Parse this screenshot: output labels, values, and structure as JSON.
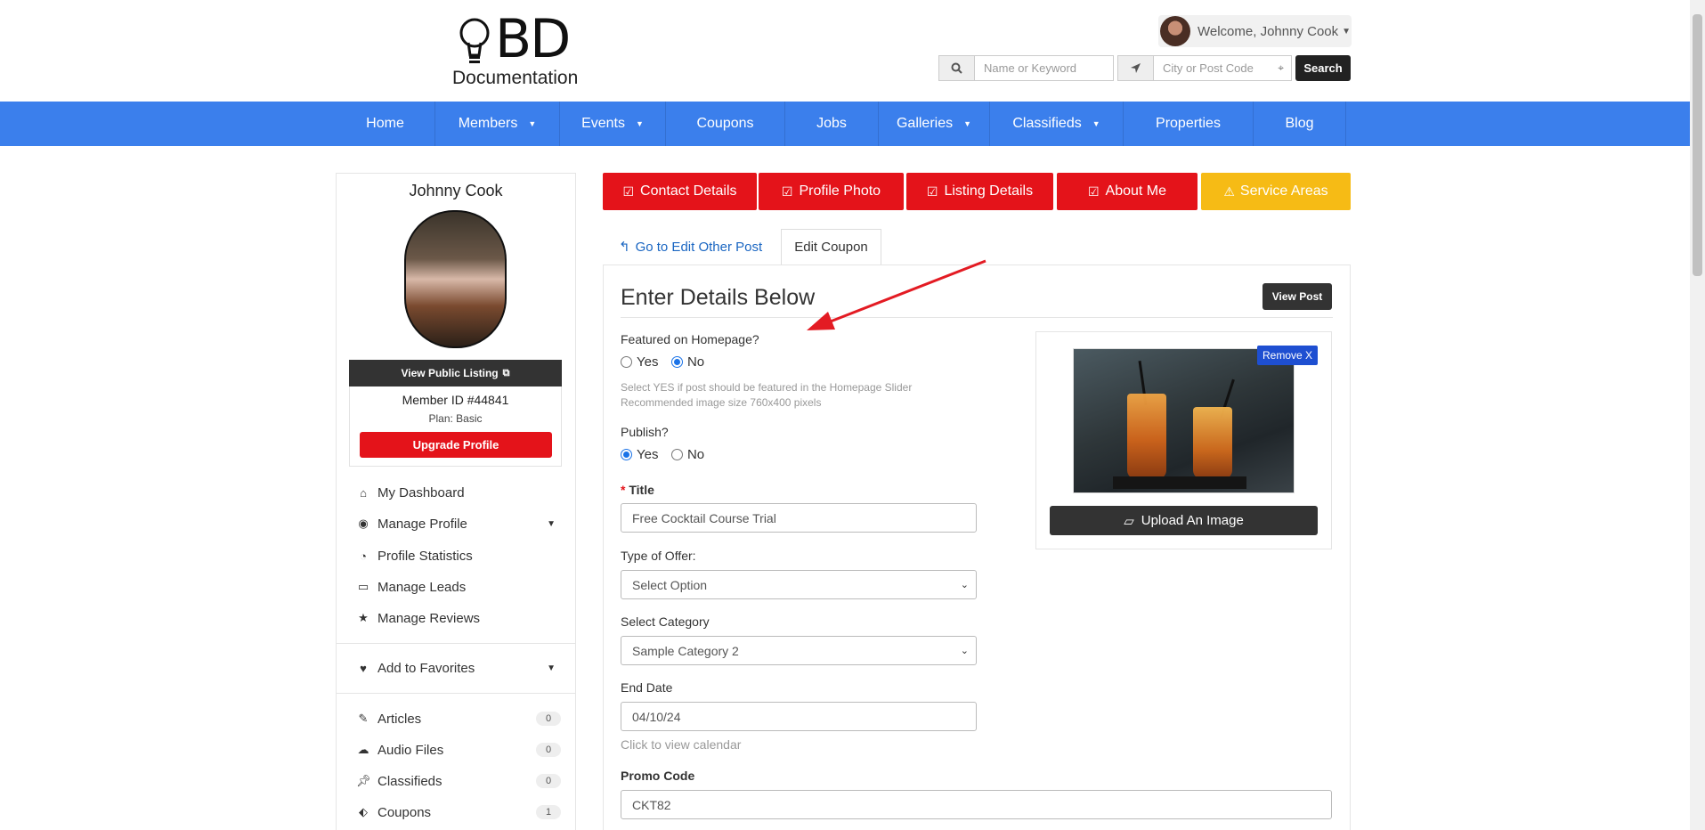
{
  "header": {
    "logo_text": "BD",
    "logo_sub": "Documentation",
    "welcome": "Welcome, Johnny Cook",
    "search_name_placeholder": "Name or Keyword",
    "search_location_placeholder": "City or Post Code",
    "search_button": "Search"
  },
  "nav": {
    "items": [
      {
        "label": "Home"
      },
      {
        "label": "Members",
        "dropdown": "▼"
      },
      {
        "label": "Events",
        "dropdown": "▼"
      },
      {
        "label": "Coupons"
      },
      {
        "label": "Jobs"
      },
      {
        "label": "Galleries",
        "dropdown": "▼"
      },
      {
        "label": "Classifieds",
        "dropdown": "▼"
      },
      {
        "label": "Properties"
      },
      {
        "label": "Blog"
      }
    ]
  },
  "sidebar": {
    "name": "Johnny Cook",
    "view_public_listing": "View Public Listing",
    "member_id": "Member ID #44841",
    "plan": "Plan: Basic",
    "upgrade": "Upgrade Profile",
    "links": [
      {
        "label": "My Dashboard",
        "icon": "home-icon"
      },
      {
        "label": "Manage Profile",
        "icon": "user-circle-icon"
      },
      {
        "label": "Profile Statistics",
        "icon": "pie-chart-icon"
      },
      {
        "label": "Manage Leads",
        "icon": "folder-open-icon"
      },
      {
        "label": "Manage Reviews",
        "icon": "star-icon"
      }
    ],
    "favorites": "Add to Favorites",
    "posts": [
      {
        "label": "Articles",
        "count": "0"
      },
      {
        "label": "Audio Files",
        "count": "0"
      },
      {
        "label": "Classifieds",
        "count": "0"
      },
      {
        "label": "Coupons",
        "count": "1"
      }
    ]
  },
  "top_tabs": {
    "contact": "Contact Details",
    "photo": "Profile Photo",
    "listing": "Listing Details",
    "about": "About Me",
    "service": "Service Areas"
  },
  "subtabs": {
    "back": "Go to Edit Other Post",
    "active": "Edit Coupon"
  },
  "form": {
    "heading": "Enter Details Below",
    "view_post": "View Post",
    "featured_label": "Featured on Homepage?",
    "yes": "Yes",
    "no": "No",
    "featured_help_1": "Select YES if post should be featured in the Homepage Slider",
    "featured_help_2": "Recommended image size 760x400 pixels",
    "publish_label": "Publish?",
    "title_label": "Title",
    "title_value": "Free Cocktail Course Trial",
    "offer_label": "Type of Offer:",
    "offer_value": "Select Option",
    "category_label": "Select Category",
    "category_value": "Sample Category 2",
    "end_date_label": "End Date",
    "end_date_value": "04/10/24",
    "end_date_help": "Click to view calendar",
    "promo_label": "Promo Code",
    "promo_value": "CKT82",
    "remove": "Remove X",
    "upload": "Upload An Image",
    "featured_selected": "No",
    "publish_selected": "Yes"
  },
  "colors": {
    "nav_blue": "#3b7fec",
    "red": "#e4131a",
    "yellow": "#f6bb15",
    "arrow": "#e31b23"
  }
}
